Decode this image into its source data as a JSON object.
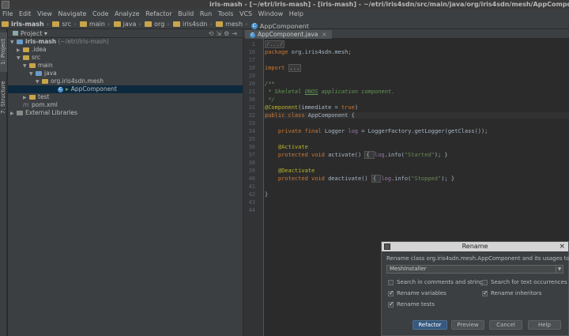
{
  "window": {
    "title": "iris-mash - [~/etri/iris-mash] - [iris-mash] - ~/etri/iris4sdn/src/main/java/org/iris4sdn/mesh/AppComponent.java - IntelliJ IDEA"
  },
  "menu": [
    "File",
    "Edit",
    "View",
    "Navigate",
    "Code",
    "Analyze",
    "Refactor",
    "Build",
    "Run",
    "Tools",
    "VCS",
    "Window",
    "Help"
  ],
  "breadcrumbs": [
    "iris-mash",
    "src",
    "main",
    "java",
    "org",
    "iris4sdn",
    "mesh",
    "AppComponent"
  ],
  "side_tabs": [
    "1: Project",
    "7: Structure"
  ],
  "project_panel": {
    "title": "Project",
    "tree": [
      {
        "label": "iris-mash",
        "suffix": "(~/etri/iris-mash)"
      },
      {
        "label": ".idea"
      },
      {
        "label": "src"
      },
      {
        "label": "main"
      },
      {
        "label": "java"
      },
      {
        "label": "org.iris4sdn.mesh"
      },
      {
        "label": "AppComponent"
      },
      {
        "label": "test"
      },
      {
        "label": "pom.xml"
      },
      {
        "label": "External Libraries"
      }
    ]
  },
  "editor": {
    "tab": "AppComponent.java",
    "line_numbers": [
      "1",
      "16",
      "17",
      "18",
      "19",
      "20",
      "21",
      "30",
      "31",
      "32",
      "33",
      "34",
      "35",
      "36",
      "37",
      "38",
      "39",
      "40",
      "41",
      "42",
      "43",
      "44"
    ],
    "code": {
      "l1": "/.../",
      "l16a": "package",
      "l16b": " org.iris4sdn.mesh;",
      "l18a": "import",
      "l18b": "...",
      "l20": "/**",
      "l21a": " * Skeletal ",
      "l21b": "ONOS",
      "l21c": " application component.",
      "l22": " */",
      "l23a": "@Component",
      "l23b": "(immediate = ",
      "l23c": "true",
      "l23d": ")",
      "l24a": "public class",
      "l24b": " AppComponent {",
      "l26a": "    private final",
      "l26b": " Logger ",
      "l26c": "log",
      "l26d": " = LoggerFactory.getLogger(getClass());",
      "l28": "    @Activate",
      "l29a": "    protected void",
      "l29b": " activate() ",
      "l29c": "{ ",
      "l29d": "log",
      "l29e": ".info(",
      "l29f": "\"Started\"",
      "l29g": "); }",
      "l31": "    @Deactivate",
      "l32a": "    protected void",
      "l32b": " deactivate() ",
      "l32c": "{ ",
      "l32d": "log",
      "l32e": ".info(",
      "l32f": "\"Stopped\"",
      "l32g": "); }",
      "l34": "}"
    }
  },
  "rename_dialog": {
    "title": "Rename",
    "description": "Rename class org.iris4sdn.mesh.AppComponent and its usages to:",
    "new_name": "MeshInstaller",
    "options": {
      "search_comments": {
        "label": "Search in comments and strings",
        "checked": false
      },
      "search_text": {
        "label": "Search for text occurrences",
        "checked": false
      },
      "rename_variables": {
        "label": "Rename variables",
        "checked": true
      },
      "rename_inheritors": {
        "label": "Rename inheritors",
        "checked": true
      },
      "rename_tests": {
        "label": "Rename tests",
        "checked": true
      }
    },
    "buttons": {
      "refactor": "Refactor",
      "preview": "Preview",
      "cancel": "Cancel",
      "help": "Help"
    }
  }
}
